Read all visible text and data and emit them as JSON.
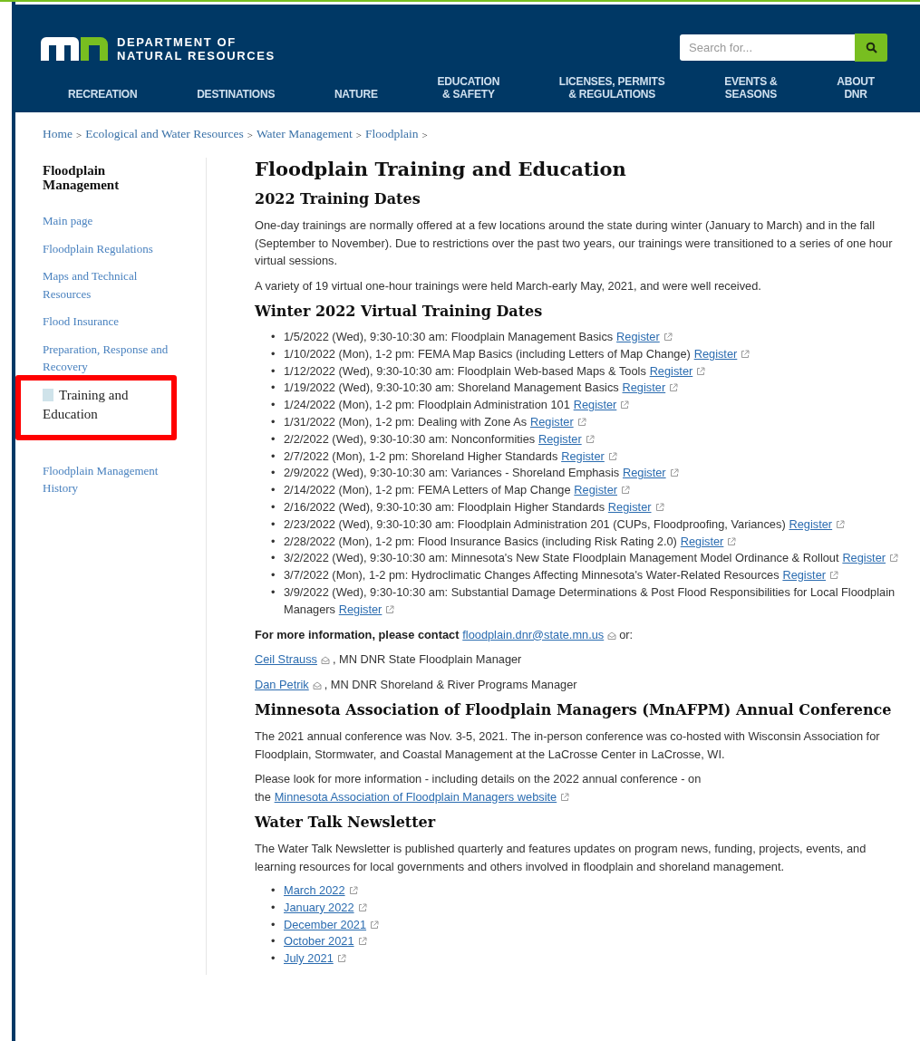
{
  "header": {
    "logo_lines": [
      "DEPARTMENT OF",
      "NATURAL RESOURCES"
    ],
    "search": {
      "placeholder": "Search for..."
    },
    "nav": [
      {
        "lines": [
          "RECREATION"
        ]
      },
      {
        "lines": [
          "DESTINATIONS"
        ]
      },
      {
        "lines": [
          "NATURE"
        ]
      },
      {
        "lines": [
          "EDUCATION",
          "& SAFETY"
        ]
      },
      {
        "lines": [
          "LICENSES, PERMITS",
          "& REGULATIONS"
        ]
      },
      {
        "lines": [
          "EVENTS &",
          "SEASONS"
        ]
      },
      {
        "lines": [
          "ABOUT",
          "DNR"
        ]
      }
    ]
  },
  "breadcrumb": {
    "separator": ">",
    "items": [
      "Home",
      "Ecological and Water Resources",
      "Water Management",
      "Floodplain"
    ]
  },
  "sidebar": {
    "title": "Floodplain Management",
    "items": [
      {
        "label": "Main page",
        "selected": false
      },
      {
        "label": "Floodplain Regulations",
        "selected": false
      },
      {
        "label": "Maps and Technical Resources",
        "selected": false
      },
      {
        "label": "Flood Insurance",
        "selected": false
      },
      {
        "label": "Preparation, Response and Recovery",
        "selected": false
      },
      {
        "label": "Training and Education",
        "selected": true
      },
      {
        "label": "Floodplain Management History",
        "selected": false
      }
    ]
  },
  "content": [
    {
      "kind": "h1",
      "text": "Floodplain Training and Education"
    },
    {
      "kind": "h2",
      "text": "2022 Training Dates"
    },
    {
      "kind": "p",
      "parts": [
        {
          "kind": "text",
          "text": "One-day trainings are normally offered at a few locations around the state during winter (January to March) and in the fall (September to November). Due to restrictions over the past two years, our trainings were transitioned to a series of one hour virtual sessions."
        }
      ]
    },
    {
      "kind": "p",
      "parts": [
        {
          "kind": "text",
          "text": "A variety of 19 virtual one-hour trainings were held March-early May, 2021, and were well received."
        }
      ]
    },
    {
      "kind": "h2",
      "text": "Winter 2022 Virtual Training Dates"
    },
    {
      "kind": "list",
      "marker": "•",
      "items": [
        {
          "text": "1/5/2022 (Wed), 9:30-10:30 am: Floodplain Management Basics",
          "link": "Register"
        },
        {
          "text": "1/10/2022 (Mon), 1-2 pm: FEMA Map Basics (including Letters of Map Change)",
          "link": "Register"
        },
        {
          "text": "1/12/2022 (Wed), 9:30-10:30 am: Floodplain Web-based Maps & Tools",
          "link": "Register"
        },
        {
          "text": "1/19/2022 (Wed), 9:30-10:30 am: Shoreland Management Basics",
          "link": "Register"
        },
        {
          "text": "1/24/2022 (Mon), 1-2 pm: Floodplain Administration 101",
          "link": "Register"
        },
        {
          "text": "1/31/2022 (Mon), 1-2 pm: Dealing with Zone As",
          "link": "Register"
        },
        {
          "text": "2/2/2022 (Wed), 9:30-10:30 am: Nonconformities",
          "link": "Register"
        },
        {
          "text": "2/7/2022 (Mon), 1-2 pm: Shoreland Higher Standards",
          "link": "Register"
        },
        {
          "text": "2/9/2022 (Wed), 9:30-10:30 am: Variances - Shoreland Emphasis",
          "link": "Register"
        },
        {
          "text": "2/14/2022 (Mon), 1-2 pm: FEMA Letters of Map Change",
          "link": "Register"
        },
        {
          "text": "2/16/2022 (Wed), 9:30-10:30 am: Floodplain Higher Standards",
          "link": "Register"
        },
        {
          "text": "2/23/2022 (Wed), 9:30-10:30 am: Floodplain Administration 201 (CUPs, Floodproofing, Variances)",
          "link": "Register"
        },
        {
          "text": "2/28/2022 (Mon), 1-2 pm: Flood Insurance Basics (including Risk Rating 2.0)",
          "link": "Register"
        },
        {
          "text": "3/2/2022 (Wed), 9:30-10:30 am: Minnesota's New State Floodplain Management Model Ordinance & Rollout",
          "link": "Register"
        },
        {
          "text": "3/7/2022 (Mon), 1-2 pm: Hydroclimatic Changes Affecting Minnesota's Water-Related Resources",
          "link": "Register"
        },
        {
          "text": "3/9/2022 (Wed), 9:30-10:30 am: Substantial Damage Determinations & Post Flood Responsibilities for Local Floodplain Managers",
          "link": "Register"
        }
      ]
    },
    {
      "kind": "p",
      "parts": [
        {
          "kind": "bold",
          "text": "For more information, please contact"
        },
        {
          "kind": "mail",
          "text": "floodplain.dnr@state.mn.us"
        },
        {
          "kind": "text",
          "text": "or:"
        }
      ]
    },
    {
      "kind": "p",
      "parts": [
        {
          "kind": "mail",
          "text": "Ceil Strauss"
        },
        {
          "kind": "text",
          "text": ", MN DNR State Floodplain Manager"
        }
      ]
    },
    {
      "kind": "p",
      "parts": [
        {
          "kind": "mail",
          "text": "Dan Petrik"
        },
        {
          "kind": "text",
          "text": ", MN DNR Shoreland & River Programs Manager"
        }
      ]
    },
    {
      "kind": "h2",
      "text": "Minnesota Association of Floodplain Managers (MnAFPM) Annual Conference"
    },
    {
      "kind": "p",
      "parts": [
        {
          "kind": "text",
          "text": "The 2021 annual conference was Nov. 3-5, 2021. The in-person conference was co-hosted with Wisconsin Association for Floodplain, Stormwater, and Coastal Management at the LaCrosse Center in LaCrosse, WI."
        }
      ]
    },
    {
      "kind": "p",
      "parts": [
        {
          "kind": "text",
          "text": "Please look for more information - including details on the 2022 annual conference - on the"
        },
        {
          "kind": "external",
          "text": "Minnesota Association of Floodplain Managers website"
        }
      ]
    },
    {
      "kind": "h2",
      "text": "Water Talk Newsletter"
    },
    {
      "kind": "p",
      "parts": [
        {
          "kind": "text",
          "text": "The Water Talk Newsletter is published quarterly and features updates on program news, funding, projects, events, and learning resources for local governments and others involved in floodplain and shoreland management."
        }
      ]
    },
    {
      "kind": "list",
      "marker": "•",
      "items": [
        {
          "link": "March 2022"
        },
        {
          "link": "January 2022"
        },
        {
          "link": "December 2021"
        },
        {
          "link": "October 2021"
        },
        {
          "link": "July 2021"
        }
      ]
    }
  ]
}
